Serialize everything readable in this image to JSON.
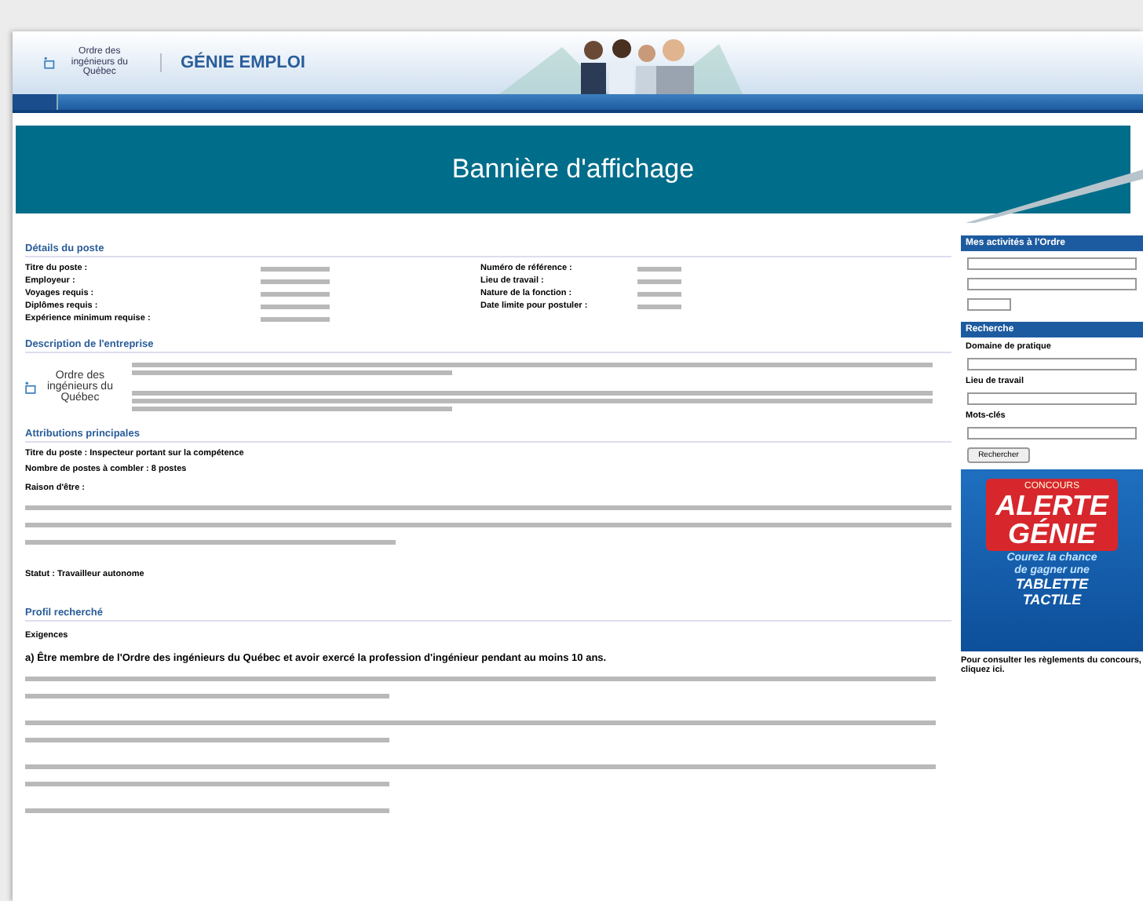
{
  "header": {
    "logo_text": "Ordre des ingénieurs du Québec",
    "site_name": "GÉNIE EMPLOI"
  },
  "banner": {
    "label": "Bannière d'affichage"
  },
  "details": {
    "title": "Détails du poste",
    "left": [
      "Titre du poste :",
      "Employeur :",
      "Voyages requis :",
      "Diplômes requis :",
      "Expérience minimum requise :"
    ],
    "right": [
      "Numéro de référence :",
      "Lieu de travail :",
      "Nature de la fonction :",
      "Date limite pour postuler :"
    ]
  },
  "description": {
    "title": "Description de l'entreprise",
    "logo_text": "Ordre des ingénieurs du Québec"
  },
  "attributions": {
    "title": "Attributions principales",
    "lines": [
      "Titre du poste : Inspecteur portant sur la compétence",
      "Nombre de postes à combler : 8 postes"
    ],
    "raison": "Raison d'être :",
    "statut": "Statut : Travailleur autonome"
  },
  "profil": {
    "title": "Profil recherché",
    "exigences": "Exigences",
    "requirement": "a) Être membre de l'Ordre des ingénieurs du Québec et avoir exercé la profession d'ingénieur pendant au moins 10 ans."
  },
  "sidebar": {
    "activities_title": "Mes activités à l'Ordre",
    "search_title": "Recherche",
    "search_labels": [
      "Domaine de pratique",
      "Lieu de travail",
      "Mots-clés"
    ],
    "search_button": "Rechercher"
  },
  "ad": {
    "top": "CONCOURS",
    "word1": "ALERTE",
    "word2": "GÉNIE",
    "line1": "Courez la chance",
    "line2": "de gagner une",
    "prize1": "TABLETTE",
    "prize2": "TACTILE"
  },
  "footer_note": "Pour consulter les règlements du concours, cliquez ici."
}
